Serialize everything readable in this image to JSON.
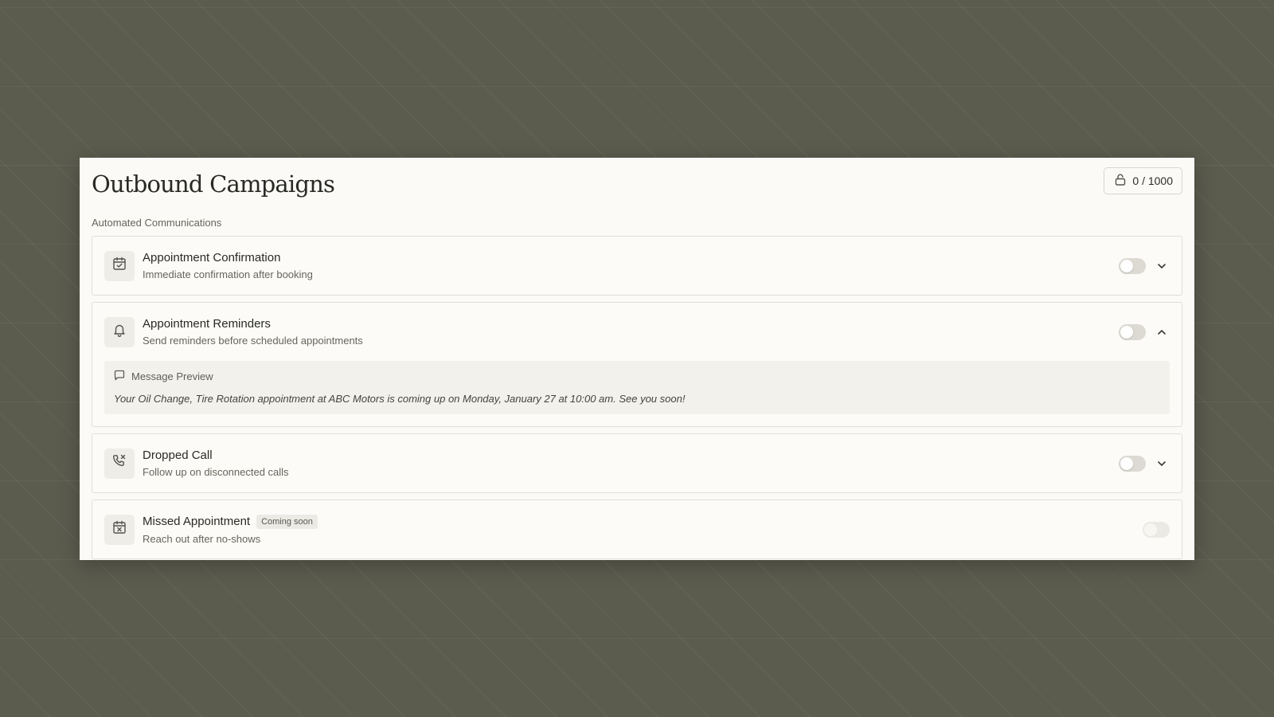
{
  "header": {
    "title": "Outbound Campaigns",
    "usage_counter": "0 / 1000",
    "usage_icon": "lock-icon"
  },
  "section": {
    "label": "Automated Communications"
  },
  "campaigns": [
    {
      "title": "Appointment Confirmation",
      "description": "Immediate confirmation after booking",
      "icon": "calendar-check-icon",
      "enabled": false,
      "expanded": false
    },
    {
      "title": "Appointment Reminders",
      "description": "Send reminders before scheduled appointments",
      "icon": "bell-icon",
      "enabled": false,
      "expanded": true,
      "preview": {
        "label": "Message Preview",
        "icon": "message-icon",
        "message": "Your Oil Change, Tire Rotation appointment at ABC Motors is coming up on Monday, January 27 at 10:00 am. See you soon!"
      }
    },
    {
      "title": "Dropped Call",
      "description": "Follow up on disconnected calls",
      "icon": "phone-missed-icon",
      "enabled": false,
      "expanded": false
    },
    {
      "title": "Missed Appointment",
      "badge": "Coming soon",
      "description": "Reach out after no-shows",
      "icon": "calendar-x-icon",
      "enabled": false,
      "disabled": true
    }
  ],
  "colors": {
    "background": "#5b5b4e",
    "panel": "#fbfaf7",
    "toggle_off": "#dcdad2",
    "text_primary": "#2a2a24",
    "text_secondary": "#66655c"
  }
}
